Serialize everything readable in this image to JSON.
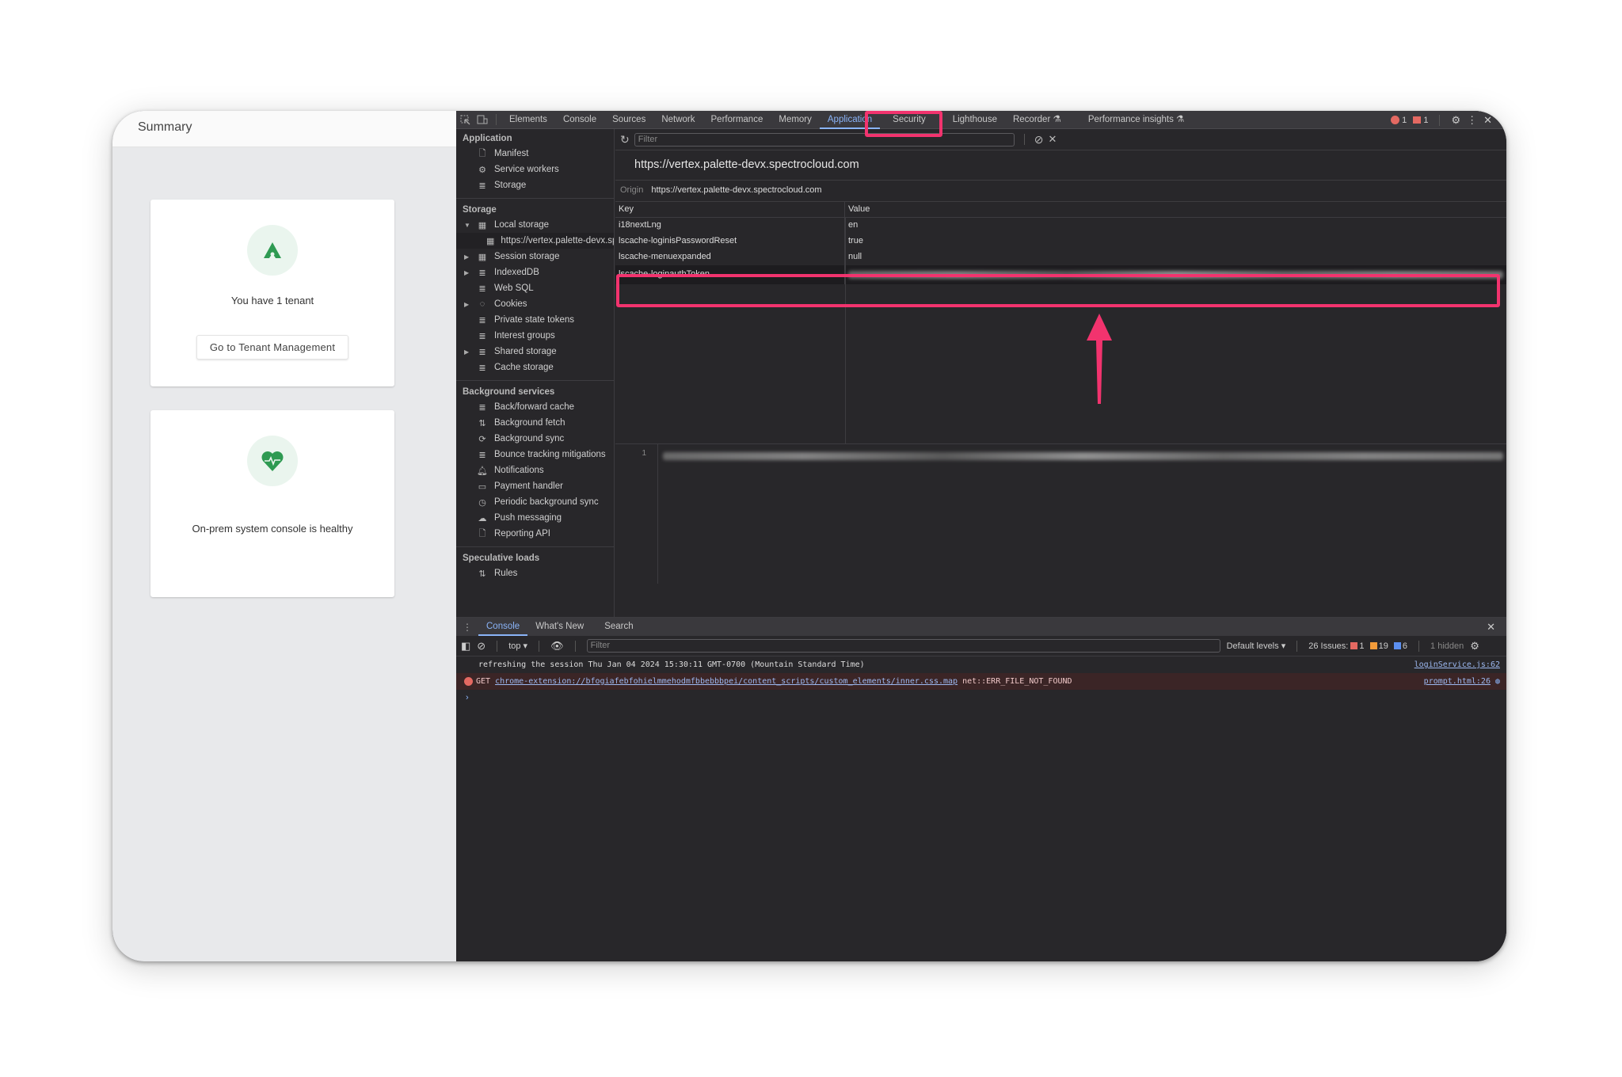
{
  "app": {
    "header_title": "Summary",
    "tenant_card": {
      "icon": "palette-logo-icon",
      "text": "You have 1 tenant",
      "button_label": "Go to Tenant Management"
    },
    "health_card": {
      "icon": "heart-pulse-icon",
      "text": "On-prem system console is healthy"
    },
    "accent_color": "#2e9a52"
  },
  "devtools": {
    "tabs": [
      "Elements",
      "Console",
      "Sources",
      "Network",
      "Performance",
      "Memory",
      "Application",
      "Security",
      "Lighthouse",
      "Recorder",
      "Performance insights"
    ],
    "active_tab": "Application",
    "error_count": "1",
    "issue_count": "1",
    "sidebar": {
      "application_section": "Application",
      "application_items": [
        "Manifest",
        "Service workers",
        "Storage"
      ],
      "storage_section": "Storage",
      "storage_items": [
        "Local storage",
        "https://vertex.palette-devx.spectrocloud.com",
        "Session storage",
        "IndexedDB",
        "Web SQL",
        "Cookies",
        "Private state tokens",
        "Interest groups",
        "Shared storage",
        "Cache storage"
      ],
      "background_section": "Background services",
      "background_items": [
        "Back/forward cache",
        "Background fetch",
        "Background sync",
        "Bounce tracking mitigations",
        "Notifications",
        "Payment handler",
        "Periodic background sync",
        "Push messaging",
        "Reporting API"
      ],
      "speculative_section": "Speculative loads",
      "speculative_items": [
        "Rules"
      ]
    },
    "storage": {
      "filter_placeholder": "Filter",
      "title": "https://vertex.palette-devx.spectrocloud.com",
      "origin_label": "Origin",
      "origin_value": "https://vertex.palette-devx.spectrocloud.com",
      "columns": [
        "Key",
        "Value"
      ],
      "rows": [
        {
          "key": "i18nextLng",
          "value": "en"
        },
        {
          "key": "lscache-loginisPasswordReset",
          "value": "true"
        },
        {
          "key": "lscache-menuexpanded",
          "value": "null"
        },
        {
          "key": "lscache-loginauthToken",
          "value": "[redacted]"
        }
      ],
      "selected_row": "lscache-loginauthToken",
      "preview_line_number": "1"
    },
    "annotation": {
      "color": "#f2336e"
    },
    "drawer": {
      "tabs": [
        "Console",
        "What's New",
        "Search"
      ],
      "active_tab": "Console",
      "context": "top",
      "filter_placeholder": "Filter",
      "levels": "Default levels",
      "issues_label": "26 Issues:",
      "issues_errors": "1",
      "issues_warnings": "19",
      "issues_info": "6",
      "hidden": "1 hidden",
      "logs": [
        {
          "type": "log",
          "text": "refreshing the session Thu Jan 04 2024 15:30:11 GMT-0700 (Mountain Standard Time)",
          "source": "loginService.js:62"
        },
        {
          "type": "error",
          "method": "GET",
          "url": "chrome-extension://bfogiafebfohielmmehodmfbbebbbpei/content_scripts/custom_elements/inner.css.map",
          "message": "net::ERR_FILE_NOT_FOUND",
          "source": "prompt.html:26"
        }
      ],
      "prompt": "›"
    }
  }
}
